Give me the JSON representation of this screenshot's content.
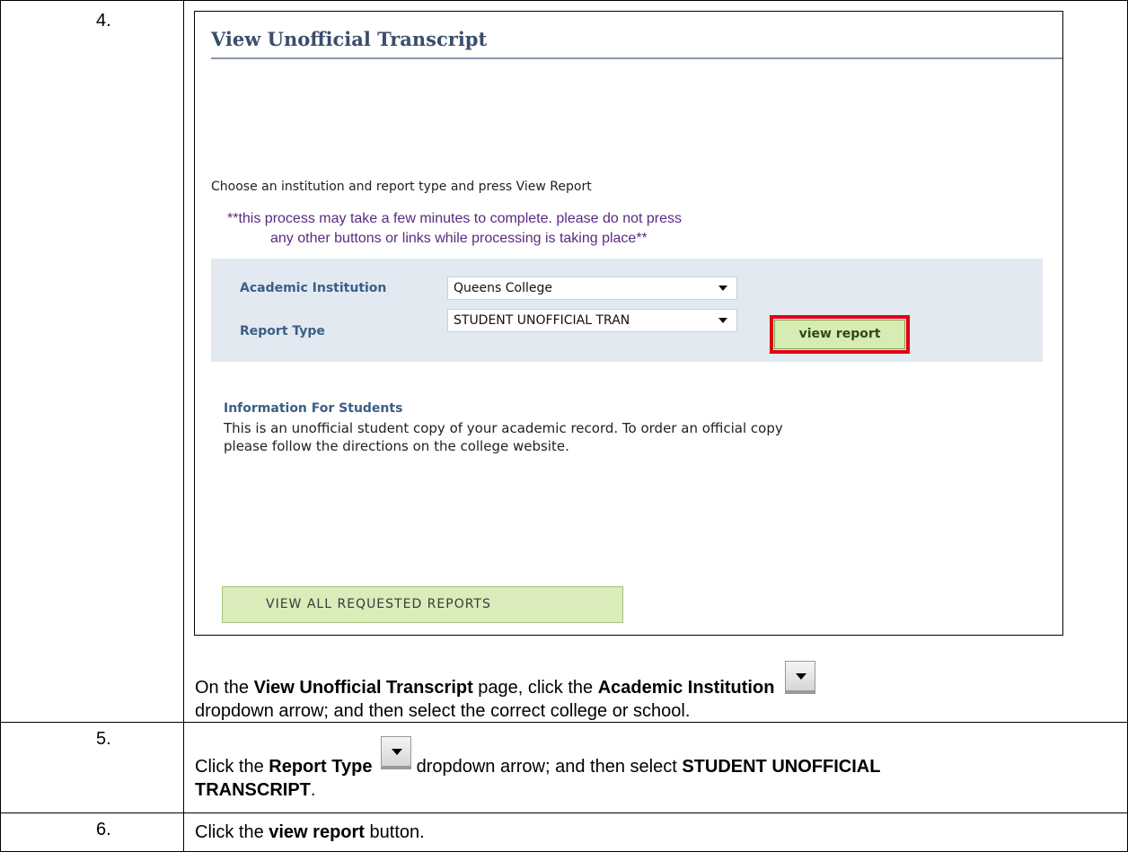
{
  "steps": [
    {
      "number": "4."
    },
    {
      "number": "5."
    },
    {
      "number": "6."
    }
  ],
  "screenshot": {
    "page_title": "View Unofficial Transcript",
    "prompt": "Choose an institution and report type and press View Report",
    "warning_line1": "**this process may take a few minutes to complete. please do not press",
    "warning_line2": "any other buttons or links while processing is taking place**",
    "institution_label": "Academic Institution",
    "institution_value": "Queens College",
    "report_type_label": "Report Type",
    "report_type_value": "STUDENT UNOFFICIAL TRAN",
    "view_report_button": "view report",
    "info_heading": "Information For Students",
    "info_body_line1": "This is an unofficial student copy of your academic record.  To order an official copy",
    "info_body_line2": "please follow the directions on the college website.",
    "view_all_button": "VIEW ALL REQUESTED REPORTS",
    "highlight_color": "#e3000f"
  },
  "instructions": {
    "step4": {
      "t1": "On the ",
      "b1": "View Unofficial Transcript",
      "t2": " page, click the ",
      "b2": "Academic Institution",
      "t3": "dropdown arrow; and then select the correct college or school."
    },
    "step5": {
      "t1": "Click the ",
      "b1": "Report Type",
      "t2": " dropdown arrow; and then select ",
      "b2": "STUDENT UNOFFICIAL",
      "b3": "TRANSCRIPT",
      "t3": "."
    },
    "step6": {
      "t1": "Click the ",
      "b1": "view report",
      "t2": " button."
    }
  },
  "icons": [
    "dropdown-arrow-icon"
  ]
}
